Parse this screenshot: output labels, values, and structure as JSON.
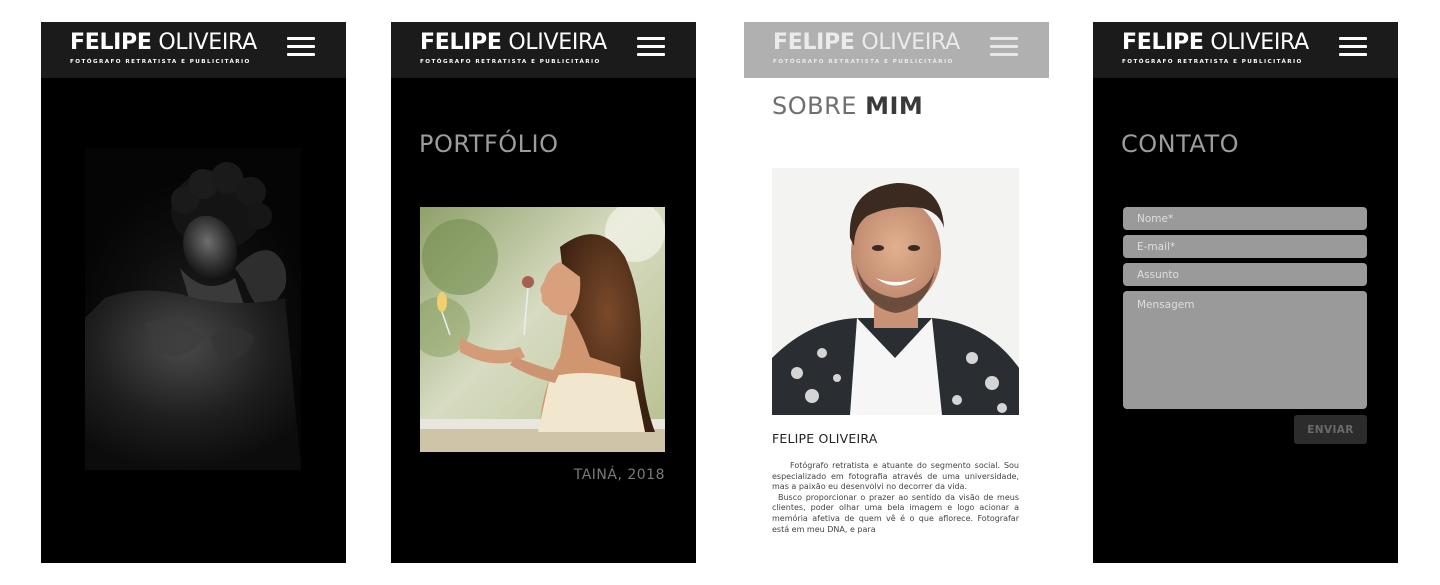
{
  "brand": {
    "first_name": "FELIPE",
    "last_name": "OLIVEIRA",
    "tagline": "FOTÓGRAFO RETRATISTA E PUBLICITÁRIO"
  },
  "icons": {
    "menu": "hamburger-menu-icon"
  },
  "colors": {
    "header_dark": "#1b1b1b",
    "header_light": "#b0b0b0",
    "input_bg": "#9a9a9a",
    "button_bg": "#2c2c2c"
  },
  "home": {
    "hero_image": "black-and-white portrait"
  },
  "portfolio": {
    "title": "PORTFÓLIO",
    "caption": "TAINÁ, 2018"
  },
  "about": {
    "title_light": "SOBRE ",
    "title_bold": "MIM",
    "name": "FELIPE OLIVEIRA",
    "paragraph1": "Fotógrafo retratista e atuante do segmento social. Sou especializado em fotografia através de uma universidade, mas a paixão eu desenvolvi no decorrer da vida.",
    "paragraph2": "Busco proporcionar o prazer ao sentido da visão de meus clientes, poder olhar uma bela imagem e logo acionar a memória afetiva de quem vê é o que aflorece. Fotografar está em meu DNA, e para"
  },
  "contact": {
    "title": "CONTATO",
    "name_placeholder": "Nome*",
    "email_placeholder": "E-mail*",
    "subject_placeholder": "Assunto",
    "message_placeholder": "Mensagem",
    "send_label": "ENVIAR"
  }
}
